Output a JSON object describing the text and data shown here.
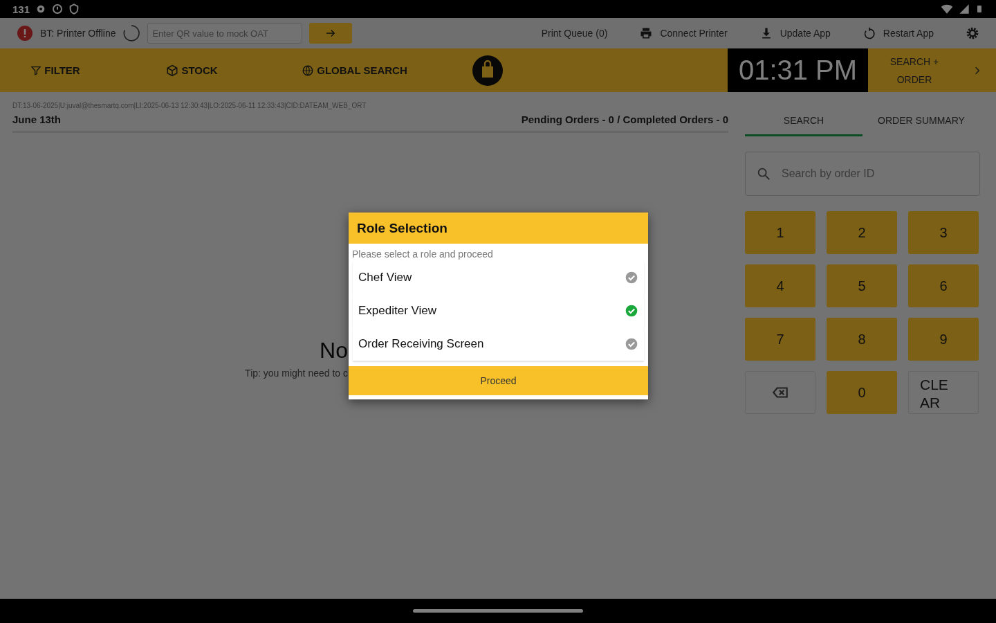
{
  "status_bar": {
    "time": "131"
  },
  "toolbar": {
    "printer_status": "BT: Printer Offline",
    "qr_field": {
      "placeholder": "Enter QR value to mock OAT"
    },
    "actions": [
      {
        "kind": "queue",
        "label": "Print Queue (0)"
      },
      {
        "kind": "printer",
        "label": "Connect Printer"
      },
      {
        "kind": "update",
        "label": "Update App"
      },
      {
        "kind": "restart",
        "label": "Restart App"
      }
    ]
  },
  "nav_bar": {
    "items": [
      {
        "kind": "filter",
        "label": "FILTER"
      },
      {
        "kind": "stock",
        "label": "STOCK"
      },
      {
        "kind": "global",
        "label": "GLOBAL SEARCH"
      }
    ],
    "clock": "01:31 PM",
    "search_order": "SEARCH + ORDER"
  },
  "orders": {
    "debug_line": "DT:13-06-2025|U:juval@thesmartq.com|LI:2025-06-13 12:30:43|LO:2025-06-11 12:33:43|CID:DATEAM_WEB_ORT",
    "date": "June 13th",
    "counts": "Pending Orders - 0 / Completed Orders - 0",
    "empty_title": "No",
    "empty_tip": "Tip: you might need to c"
  },
  "side_panel": {
    "tabs": [
      {
        "label": "SEARCH",
        "selected": true
      },
      {
        "label": "ORDER SUMMARY",
        "selected": false
      }
    ],
    "search": {
      "placeholder": "Search by order ID"
    },
    "keys": [
      {
        "kind": "digit",
        "label": "1"
      },
      {
        "kind": "digit",
        "label": "2"
      },
      {
        "kind": "digit",
        "label": "3"
      },
      {
        "kind": "digit",
        "label": "4"
      },
      {
        "kind": "digit",
        "label": "5"
      },
      {
        "kind": "digit",
        "label": "6"
      },
      {
        "kind": "digit",
        "label": "7"
      },
      {
        "kind": "digit",
        "label": "8"
      },
      {
        "kind": "digit",
        "label": "9"
      },
      {
        "kind": "backspace"
      },
      {
        "kind": "digit",
        "label": "0"
      },
      {
        "kind": "clear",
        "label": "CLEAR"
      }
    ]
  },
  "dialog": {
    "title": "Role Selection",
    "subtitle": "Please select a role and proceed",
    "roles": [
      {
        "label": "Chef View",
        "selected": false
      },
      {
        "label": "Expediter View",
        "selected": true
      },
      {
        "label": "Order Receiving Screen",
        "selected": false
      }
    ],
    "button": "Proceed"
  }
}
